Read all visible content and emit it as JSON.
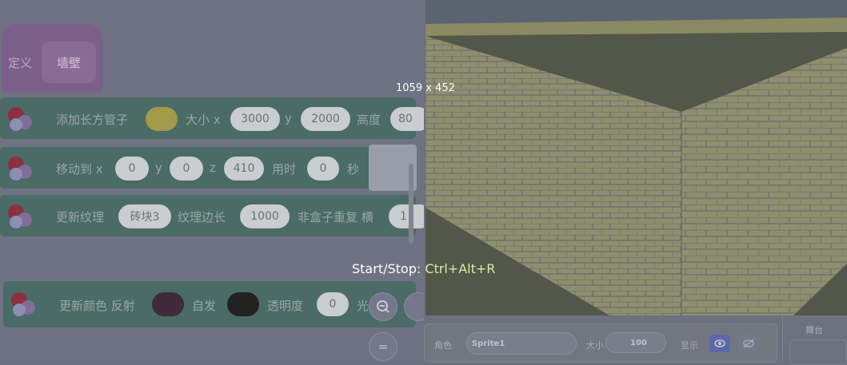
{
  "define": {
    "label": "定义",
    "name": "墙壁"
  },
  "blocks": {
    "b1": {
      "label": "添加长方管子",
      "size": "大小 x",
      "x": "3000",
      "y_label": "y",
      "y": "2000",
      "height_label": "高度",
      "height": "80"
    },
    "b2": {
      "label": "移动到 x",
      "x": "0",
      "y_label": "y",
      "y": "0",
      "z_label": "z",
      "z": "410",
      "time_label": "用时",
      "time": "0",
      "sec": "秒"
    },
    "b3": {
      "label": "更新纹理",
      "texture": "砖块3",
      "edge_label": "纹理边长",
      "edge": "1000",
      "repeat_label": "非盒子重复 横",
      "repeat": "1"
    },
    "b4": {
      "label": "更新颜色 反射",
      "emit_label": "自发",
      "alpha_label": "透明度",
      "alpha": "0",
      "light_label": "光"
    }
  },
  "colors": {
    "b1_swatch": "#a39a4a",
    "b4_reflect": "#3e2a3a",
    "b4_emit": "#222222"
  },
  "zoom": {
    "zoom_out_icon": "zoom-out-icon",
    "reset_icon": "equals-icon"
  },
  "overlay": {
    "dimensions": "1059 x 452",
    "start_stop_label": "Start/Stop: ",
    "start_stop_keys": "Ctrl+Alt+R"
  },
  "sprite": {
    "sprite_label": "角色",
    "sprite_name": "Sprite1",
    "size_label": "大小",
    "size_value": "100",
    "show_label": "显示"
  },
  "stage_tab": {
    "label": "舞台"
  }
}
